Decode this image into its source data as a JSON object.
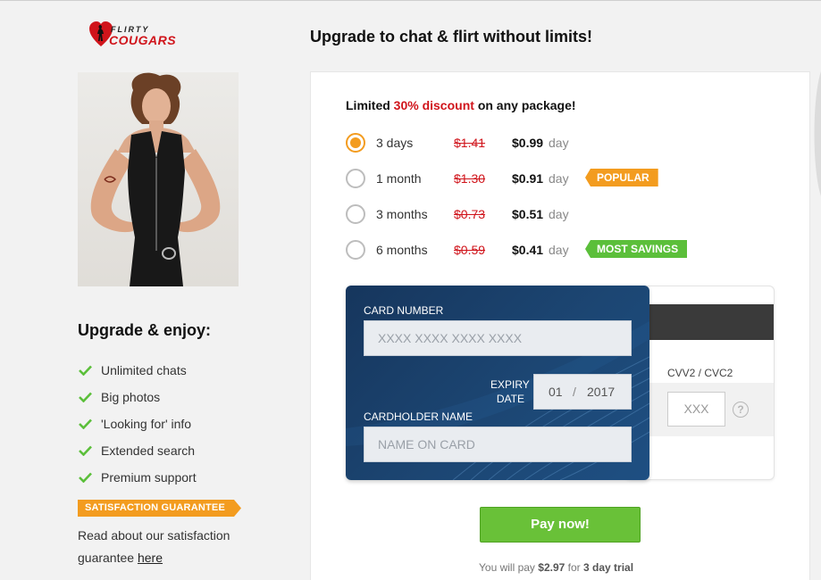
{
  "brand": {
    "logo_line1": "FLIRTY",
    "logo_line2": "COUGARS",
    "accent": "#d0141b"
  },
  "headline": "Upgrade to chat & flirt without limits!",
  "discount": {
    "prefix": "Limited",
    "highlight": "30% discount",
    "suffix": "on any package!"
  },
  "plans": [
    {
      "period": "3 days",
      "old_price": "$1.41",
      "price": "$0.99",
      "unit": "day",
      "selected": true,
      "tag": ""
    },
    {
      "period": "1 month",
      "old_price": "$1.30",
      "price": "$0.91",
      "unit": "day",
      "selected": false,
      "tag": "POPULAR"
    },
    {
      "period": "3 months",
      "old_price": "$0.73",
      "price": "$0.51",
      "unit": "day",
      "selected": false,
      "tag": ""
    },
    {
      "period": "6 months",
      "old_price": "$0.59",
      "price": "$0.41",
      "unit": "day",
      "selected": false,
      "tag": "MOST SAVINGS"
    }
  ],
  "card": {
    "number_label": "CARD NUMBER",
    "number_placeholder": "XXXX XXXX XXXX XXXX",
    "expiry_label_1": "EXPIRY",
    "expiry_label_2": "DATE",
    "expiry_month": "01",
    "expiry_sep": "/",
    "expiry_year": "2017",
    "holder_label": "CARDHOLDER NAME",
    "holder_placeholder": "NAME ON CARD",
    "cvv_label": "CVV2 / CVC2",
    "cvv_placeholder": "XXX",
    "help": "?"
  },
  "pay_button": "Pay now!",
  "footer": {
    "prefix": "You will pay",
    "amount": "$2.97",
    "middle": "for",
    "trial": "3 day trial"
  },
  "benefits_title": "Upgrade & enjoy:",
  "benefits": [
    "Unlimited chats",
    "Big photos",
    "'Looking for' info",
    "Extended search",
    "Premium support"
  ],
  "guarantee": {
    "badge": "SATISFACTION GUARANTEE",
    "text": "Read about our satisfaction guarantee",
    "link": "here"
  },
  "colors": {
    "orange": "#f39c1f",
    "green": "#5bbf3a",
    "card_blue": "#1c4673"
  }
}
